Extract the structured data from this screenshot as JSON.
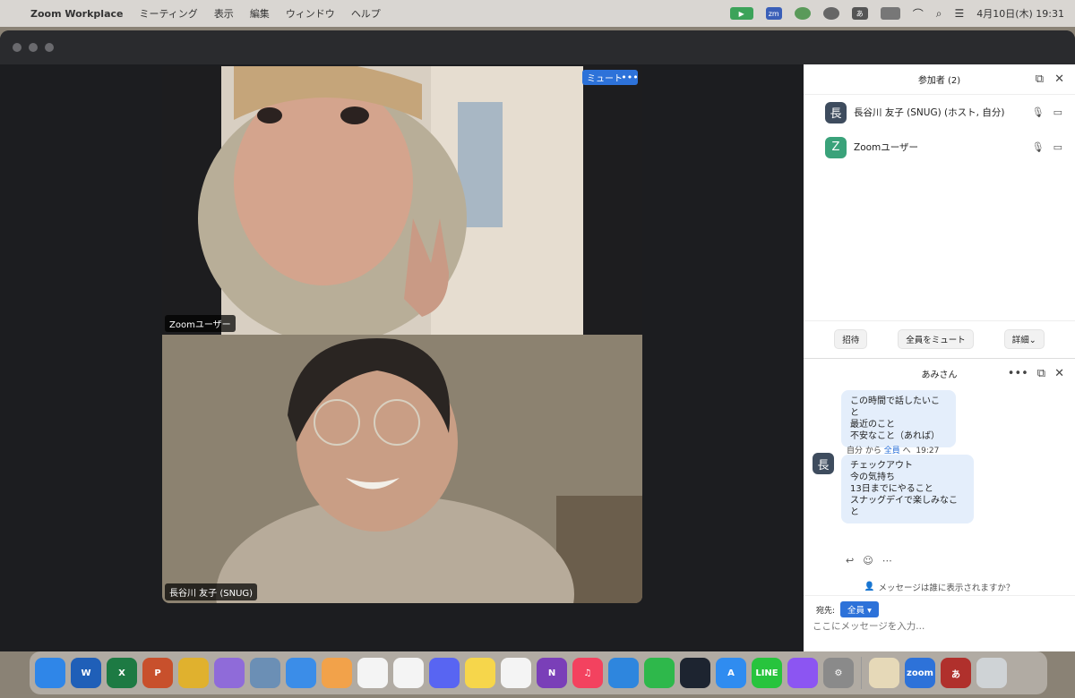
{
  "menubar": {
    "app_name": "Zoom Workplace",
    "menus": [
      "ミーティング",
      "表示",
      "編集",
      "ウィンドウ",
      "ヘルプ"
    ],
    "date_time": "4月10日(木)  19:31",
    "ime_indicator": "あ"
  },
  "video": {
    "mute_button": "ミュート",
    "more_button": "•••",
    "tile_top_name": "Zoomユーザー",
    "tile_bottom_name": "長谷川 友子 (SNUG)"
  },
  "participants": {
    "header": "参加者 (2)",
    "list": [
      {
        "avatar": "長",
        "name": "長谷川 友子 (SNUG) (ホスト, 自分)",
        "color": "#3e4c5e"
      },
      {
        "avatar": "Z",
        "name": "Zoomユーザー",
        "color": "#3aa27a"
      }
    ],
    "invite": "招待",
    "mute_all": "全員をミュート",
    "details": "詳細⌄"
  },
  "chat": {
    "header": "あみさん",
    "prev_message": [
      "この時間で話したいこと",
      "最近のこと",
      "不安なこと（あれば）"
    ],
    "msg_meta_from": "自分 から",
    "msg_meta_to": "全員",
    "msg_meta_suffix": "へ",
    "msg_time": "19:27",
    "msg_avatar": "長",
    "message": [
      "チェックアウト",
      "今の気持ち",
      "13日までにやること",
      "スナッグデイで楽しみなこと"
    ],
    "who_can_see": "メッセージは誰に表示されますか？",
    "to_label": "宛先:",
    "to_value": "全員",
    "input_placeholder": "ここにメッセージを入力..."
  },
  "dock": {
    "apps": [
      {
        "name": "finder",
        "color": "#2f86e8",
        "label": ""
      },
      {
        "name": "word",
        "color": "#1f5fb8",
        "label": "W"
      },
      {
        "name": "excel",
        "color": "#1d7a43",
        "label": "X"
      },
      {
        "name": "powerpoint",
        "color": "#c8502c",
        "label": "P"
      },
      {
        "name": "chrome",
        "color": "#e0b12e",
        "label": ""
      },
      {
        "name": "launchpad",
        "color": "#8f6bd9",
        "label": ""
      },
      {
        "name": "preview",
        "color": "#6b8fb5",
        "label": ""
      },
      {
        "name": "mail",
        "color": "#3b8de8",
        "label": ""
      },
      {
        "name": "photos",
        "color": "#f2a24a",
        "label": ""
      },
      {
        "name": "reminders",
        "color": "#f4f4f4",
        "label": ""
      },
      {
        "name": "slack",
        "color": "#f4f4f4",
        "label": ""
      },
      {
        "name": "discord",
        "color": "#5865f2",
        "label": ""
      },
      {
        "name": "notes",
        "color": "#f6d64b",
        "label": ""
      },
      {
        "name": "freeform",
        "color": "#f4f4f4",
        "label": ""
      },
      {
        "name": "onenote",
        "color": "#7a3fb8",
        "label": "N"
      },
      {
        "name": "music",
        "color": "#f3425f",
        "label": "♫"
      },
      {
        "name": "keynote",
        "color": "#2e86de",
        "label": ""
      },
      {
        "name": "numbers",
        "color": "#2eb84b",
        "label": ""
      },
      {
        "name": "perplexity",
        "color": "#1d2430",
        "label": ""
      },
      {
        "name": "appstore",
        "color": "#2f8cf0",
        "label": "A"
      },
      {
        "name": "line",
        "color": "#27c43d",
        "label": "LINE"
      },
      {
        "name": "messenger",
        "color": "#8c55f2",
        "label": ""
      },
      {
        "name": "settings",
        "color": "#8a8a8a",
        "label": "⚙"
      },
      {
        "name": "textedit",
        "color": "#e6d9b8",
        "label": ""
      },
      {
        "name": "zoom",
        "color": "#2d72d9",
        "label": "zoom"
      },
      {
        "name": "dictionary",
        "color": "#b0302c",
        "label": "あ"
      },
      {
        "name": "trash",
        "color": "#cfd3d6",
        "label": ""
      }
    ]
  }
}
